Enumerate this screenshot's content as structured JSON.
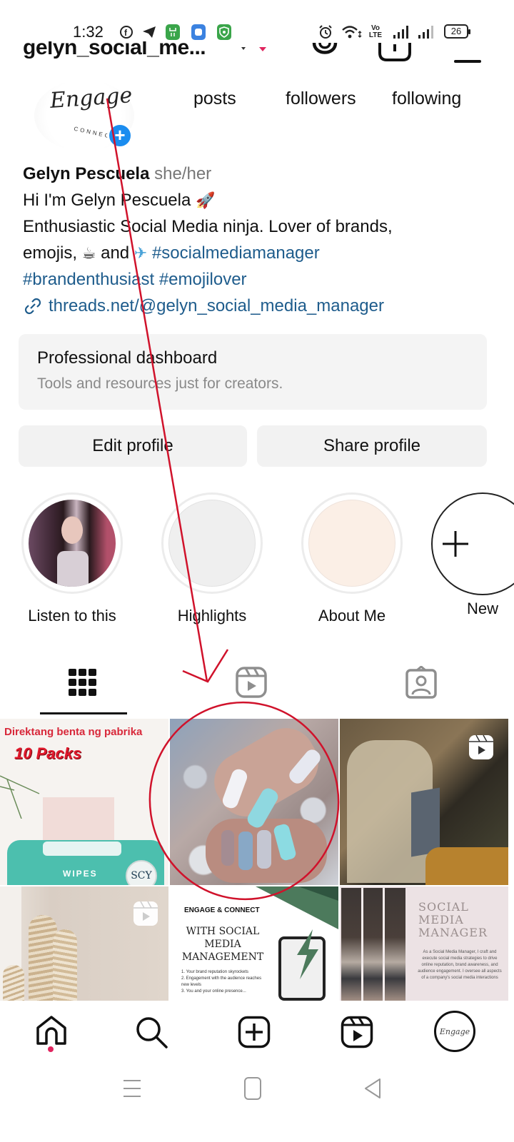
{
  "status_bar": {
    "time": "1:32",
    "left_icons": [
      "facebook-icon",
      "telegram-icon",
      "green-app-icon",
      "blue-app-icon",
      "green-shield-app-icon"
    ],
    "right_icons": [
      "alarm-icon",
      "wifi-icon",
      "volte-icon",
      "signal-icon",
      "signal-icon"
    ],
    "network_label_top": "Vo",
    "network_label_bottom": "LTE",
    "battery": "26"
  },
  "header": {
    "username": "gelyn_social_me...",
    "icons": [
      "threads-icon",
      "add-content-icon",
      "menu-icon"
    ]
  },
  "profile": {
    "avatar_text": "Engage",
    "avatar_subtext": "CONNECT",
    "stats": [
      {
        "label": "posts"
      },
      {
        "label": "followers"
      },
      {
        "label": "following"
      }
    ],
    "name": "Gelyn Pescuela",
    "pronouns": "she/her",
    "bio_line1": "Hi I'm Gelyn Pescuela",
    "bio_line1_emoji": "🚀",
    "bio_line2": "Enthusiastic Social Media ninja. Lover of brands,",
    "bio_line3_a": "emojis,",
    "bio_line3_emoji1": "☕",
    "bio_line3_b": "and",
    "bio_line3_emoji2": "✈",
    "hashtags": [
      "#socialmediamanager",
      "#brandenthusiast",
      "#emojilover"
    ],
    "link": "threads.net/@gelyn_social_media_manager"
  },
  "professional_dashboard": {
    "title": "Professional dashboard",
    "subtitle": "Tools and resources just for creators."
  },
  "buttons": {
    "edit_profile": "Edit profile",
    "share_profile": "Share profile"
  },
  "highlights": [
    {
      "label": "Listen to this",
      "type": "photo"
    },
    {
      "label": "Highlights",
      "type": "blank",
      "color": "#efefef"
    },
    {
      "label": "About Me",
      "type": "blank",
      "color": "#fbefe6"
    },
    {
      "label": "New",
      "type": "new"
    }
  ],
  "tabs": [
    {
      "name": "posts-grid",
      "active": true
    },
    {
      "name": "reels",
      "active": false
    },
    {
      "name": "tagged",
      "active": false
    }
  ],
  "grid_posts": [
    {
      "type": "image",
      "headline": "Direktang benta ng pabrika",
      "subheadline": "10 Packs",
      "product": "WIPES",
      "brand": "SCY"
    },
    {
      "type": "image",
      "description": "nail art photo",
      "highlighted": true
    },
    {
      "type": "reel",
      "description": "person with laptop"
    },
    {
      "type": "reel",
      "description": "pampas grass decor"
    },
    {
      "type": "image",
      "brand_line": "ENGAGE & CONNECT",
      "title": "WITH SOCIAL MEDIA MANAGEMENT",
      "points": [
        "1. Your brand reputation skyrockets",
        "2. Engagement with the audience reaches new levels",
        "3. You and your online presence..."
      ]
    },
    {
      "type": "image",
      "title": "SOCIAL MEDIA MANAGER",
      "body": "As a Social Media Manager, I craft and execute social media strategies to drive online reputation, brand awareness, and audience engagement. I oversee all aspects of a company's social media interactions"
    }
  ],
  "bottom_nav": [
    {
      "name": "home",
      "active": true
    },
    {
      "name": "search",
      "active": false
    },
    {
      "name": "create",
      "active": false
    },
    {
      "name": "reels",
      "active": false
    },
    {
      "name": "profile",
      "active": false
    }
  ],
  "system_nav": [
    "recents",
    "home",
    "back"
  ],
  "colors": {
    "link_blue": "#1e5c8c",
    "add_story_blue": "#1a8cef",
    "annotation_red": "#d0122b",
    "notification_dot": "#e0245e"
  }
}
